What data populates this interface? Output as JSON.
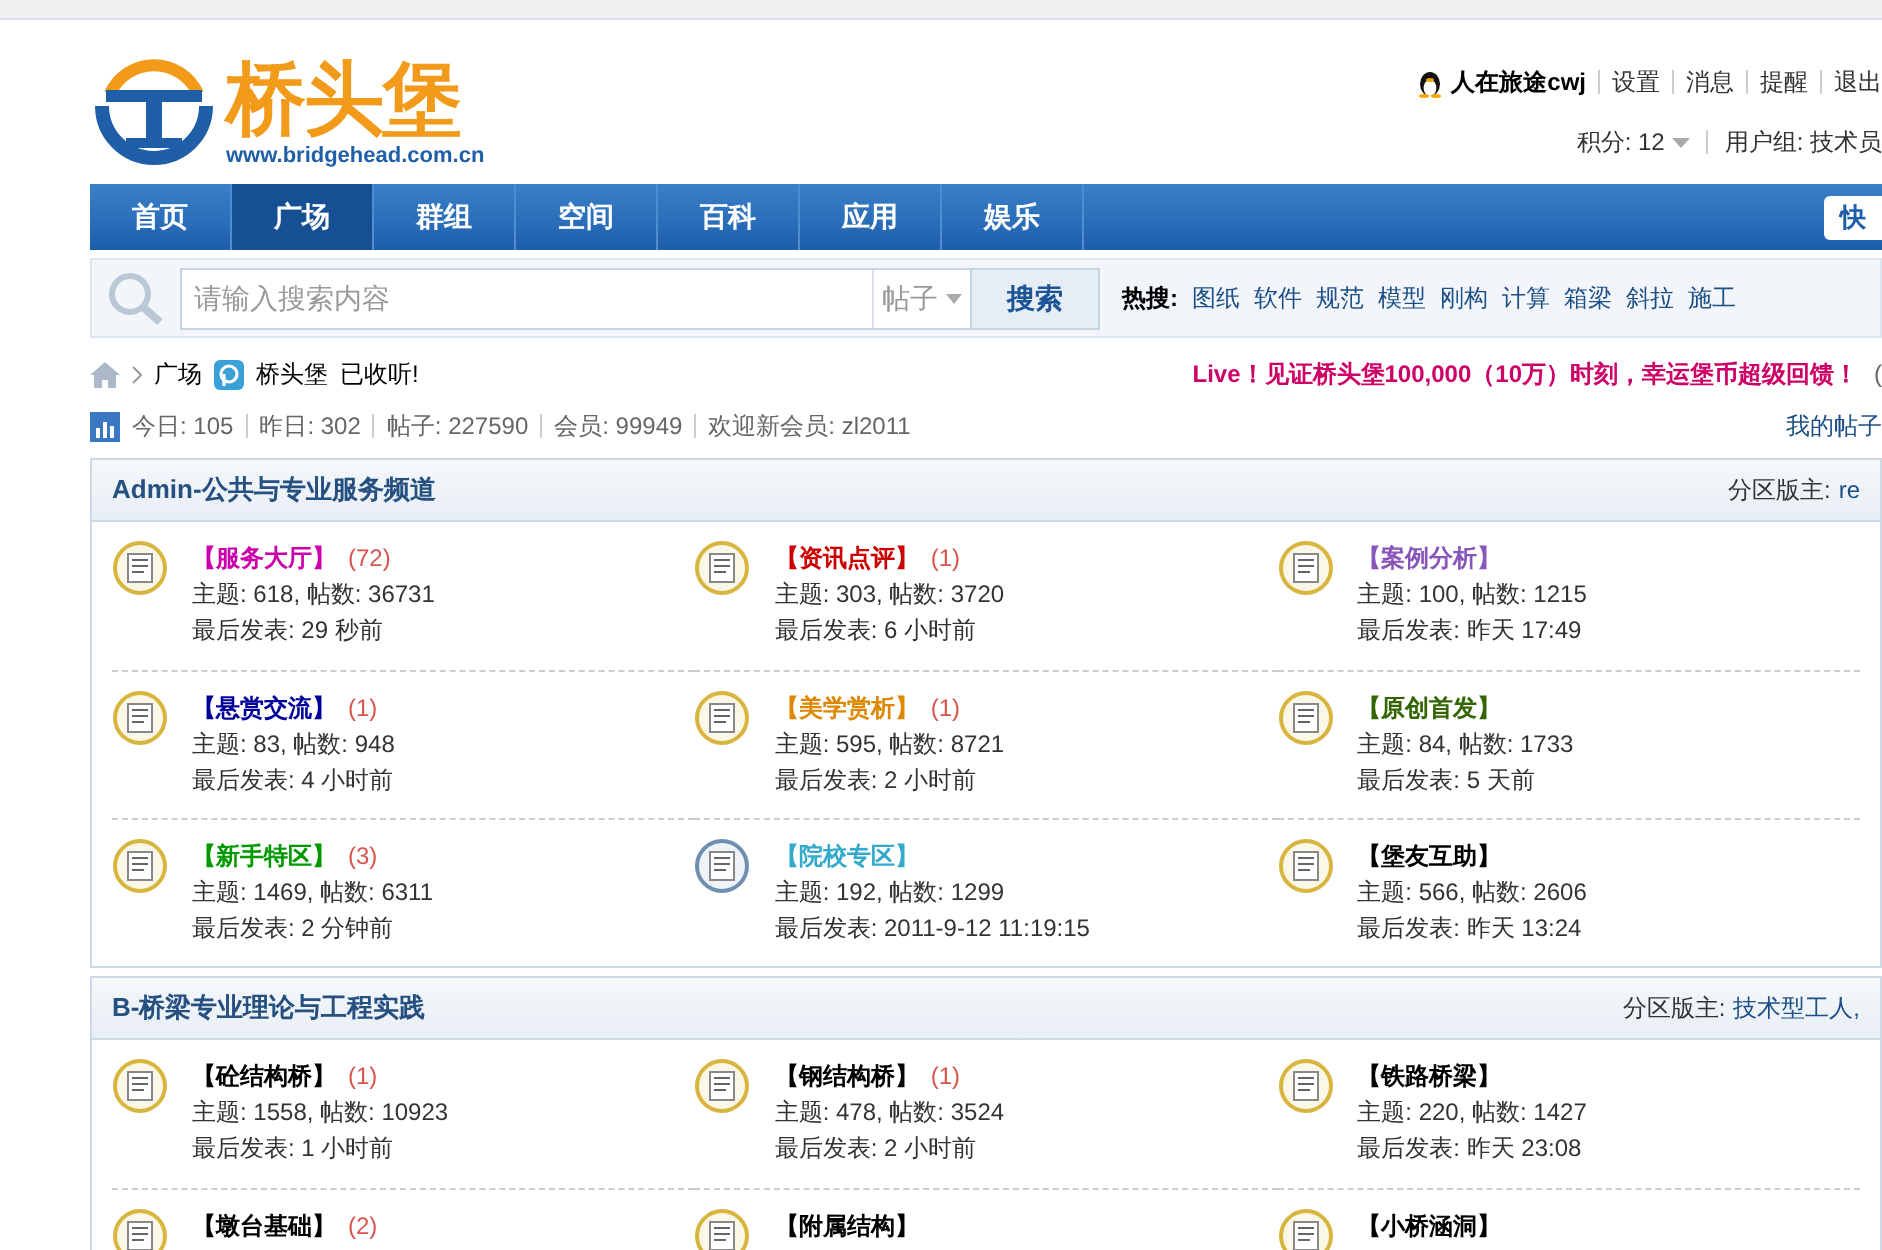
{
  "logo": {
    "name": "桥头堡",
    "url": "www.bridgehead.com.cn"
  },
  "user": {
    "name": "人在旅途cwj",
    "links": [
      "设置",
      "消息",
      "提醒",
      "退出"
    ],
    "points": "积分: 12",
    "group": "用户组: 技术员"
  },
  "nav": [
    {
      "label": "首页",
      "selected": false
    },
    {
      "label": "广场",
      "selected": true
    },
    {
      "label": "群组",
      "selected": false
    },
    {
      "label": "空间",
      "selected": false
    },
    {
      "label": "百科",
      "selected": false
    },
    {
      "label": "应用",
      "selected": false
    },
    {
      "label": "娱乐",
      "selected": false
    }
  ],
  "quick_button": "快",
  "search": {
    "placeholder": "请输入搜索内容",
    "type": "帖子",
    "button": "搜索",
    "hot_label": "热搜:",
    "hot": [
      "图纸",
      "软件",
      "规范",
      "模型",
      "刚构",
      "计算",
      "箱梁",
      "斜拉",
      "施工"
    ]
  },
  "breadcrumb": {
    "items": [
      "广场"
    ],
    "feed": "桥头堡",
    "feed_status": "已收听!",
    "announcement": "Live！见证桥头堡100,000（10万）时刻，幸运堡币超级回馈！",
    "announcement_tail": "("
  },
  "stats": {
    "items": [
      "今日: 105",
      "昨日: 302",
      "帖子: 227590",
      "会员: 99949",
      "欢迎新会员: zl2011"
    ],
    "link": "我的帖子"
  },
  "sections": [
    {
      "title": "Admin-公共与专业服务频道",
      "moderators_label": "分区版主:",
      "moderators": "re",
      "forums": [
        {
          "name": "【服务大厅】",
          "color": "#cc00aa",
          "count": "(72)",
          "new": true,
          "topics": "主题: 618, 帖数: 36731",
          "last": "最后发表: 29 秒前"
        },
        {
          "name": "【资讯点评】",
          "color": "#cc0000",
          "count": "(1)",
          "new": true,
          "topics": "主题: 303, 帖数: 3720",
          "last": "最后发表: 6 小时前"
        },
        {
          "name": "【案例分析】",
          "color": "#8855bb",
          "new": true,
          "topics": "主题: 100, 帖数: 1215",
          "last": "最后发表: 昨天 17:49"
        },
        {
          "name": "【悬赏交流】",
          "color": "#000099",
          "count": "(1)",
          "new": true,
          "topics": "主题: 83, 帖数: 948",
          "last": "最后发表: 4 小时前"
        },
        {
          "name": "【美学赏析】",
          "color": "#dd8800",
          "count": "(1)",
          "new": true,
          "topics": "主题: 595, 帖数: 8721",
          "last": "最后发表: 2 小时前"
        },
        {
          "name": "【原创首发】",
          "color": "#336600",
          "new": true,
          "topics": "主题: 84, 帖数: 1733",
          "last": "最后发表: 5 天前"
        },
        {
          "name": "【新手特区】",
          "color": "#009900",
          "count": "(3)",
          "new": true,
          "topics": "主题: 1469, 帖数: 6311",
          "last": "最后发表: 2 分钟前"
        },
        {
          "name": "【院校专区】",
          "color": "#33aacc",
          "new": false,
          "topics": "主题: 192, 帖数: 1299",
          "last": "最后发表: 2011-9-12 11:19:15"
        },
        {
          "name": "【堡友互助】",
          "color": "#000000",
          "new": true,
          "topics": "主题: 566, 帖数: 2606",
          "last": "最后发表: 昨天 13:24"
        }
      ]
    },
    {
      "title": "B-桥梁专业理论与工程实践",
      "moderators_label": "分区版主:",
      "moderators": "技术型工人,",
      "forums": [
        {
          "name": "【砼结构桥】",
          "color": "#000000",
          "count": "(1)",
          "new": true,
          "topics": "主题: 1558, 帖数: 10923",
          "last": "最后发表: 1 小时前"
        },
        {
          "name": "【钢结构桥】",
          "color": "#000000",
          "count": "(1)",
          "new": true,
          "topics": "主题: 478, 帖数: 3524",
          "last": "最后发表: 2 小时前"
        },
        {
          "name": "【铁路桥梁】",
          "color": "#000000",
          "new": true,
          "topics": "主题: 220, 帖数: 1427",
          "last": "最后发表: 昨天 23:08"
        },
        {
          "name": "【墩台基础】",
          "color": "#000000",
          "count": "(2)",
          "new": true
        },
        {
          "name": "【附属结构】",
          "color": "#000000",
          "new": true
        },
        {
          "name": "【小桥涵洞】",
          "color": "#000000",
          "new": true
        }
      ]
    }
  ]
}
